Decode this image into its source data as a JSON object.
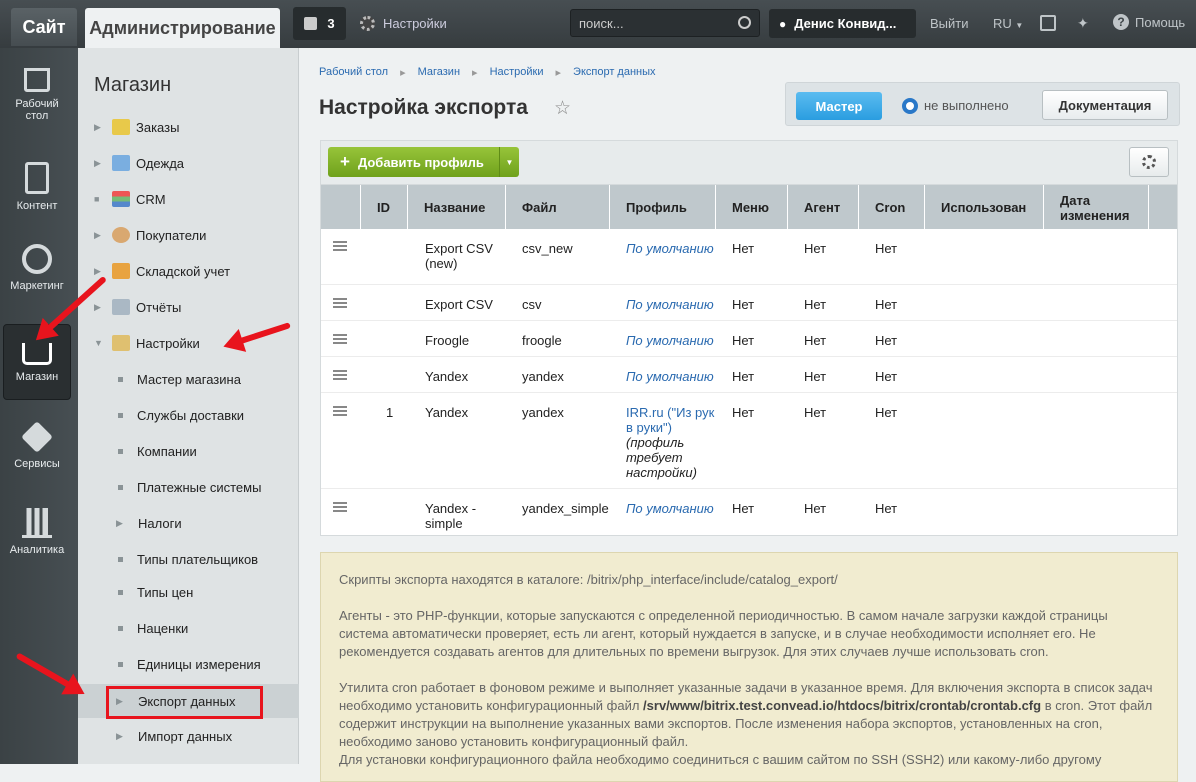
{
  "topbar": {
    "site": "Сайт",
    "admin": "Администрирование",
    "notify_count": "3",
    "settings": "Настройки",
    "search_placeholder": "поиск...",
    "user": "Денис Конвид...",
    "logout": "Выйти",
    "lang": "RU",
    "help": "Помощь"
  },
  "leftnav": {
    "items": [
      {
        "label1": "Рабочий",
        "label2": "стол"
      },
      {
        "label1": "Контент",
        "label2": ""
      },
      {
        "label1": "Маркетинг",
        "label2": ""
      },
      {
        "label1": "Магазин",
        "label2": ""
      },
      {
        "label1": "Сервисы",
        "label2": ""
      },
      {
        "label1": "Аналитика",
        "label2": ""
      }
    ]
  },
  "sidebar": {
    "title": "Магазин",
    "items": [
      "Заказы",
      "Одежда",
      "CRM",
      "Покупатели",
      "Складской учет",
      "Отчёты",
      "Настройки"
    ],
    "sub": [
      "Мастер магазина",
      "Службы доставки",
      "Компании",
      "Платежные системы",
      "Налоги",
      "Типы плательщиков",
      "Типы цен",
      "Наценки",
      "Единицы измерения",
      "Экспорт данных",
      "Импорт данных"
    ]
  },
  "breadcrumbs": [
    "Рабочий стол",
    "Магазин",
    "Настройки",
    "Экспорт данных"
  ],
  "page_title": "Настройка экспорта",
  "wizard": {
    "button": "Мастер",
    "status": "не выполнено",
    "docs": "Документация"
  },
  "toolbar": {
    "add": "Добавить профиль"
  },
  "table": {
    "headers": [
      "ID",
      "Название",
      "Файл",
      "Профиль",
      "Меню",
      "Агент",
      "Cron",
      "Использован",
      "Дата изменения"
    ],
    "rows": [
      {
        "id": "",
        "name": "Export CSV (new)",
        "file": "csv_new",
        "profile": "По умолчанию",
        "note": "",
        "menu": "Нет",
        "agent": "Нет",
        "cron": "Нет"
      },
      {
        "id": "",
        "name": "Export CSV",
        "file": "csv",
        "profile": "По умолчанию",
        "note": "",
        "menu": "Нет",
        "agent": "Нет",
        "cron": "Нет"
      },
      {
        "id": "",
        "name": "Froogle",
        "file": "froogle",
        "profile": "По умолчанию",
        "note": "",
        "menu": "Нет",
        "agent": "Нет",
        "cron": "Нет"
      },
      {
        "id": "",
        "name": "Yandex",
        "file": "yandex",
        "profile": "По умолчанию",
        "note": "",
        "menu": "Нет",
        "agent": "Нет",
        "cron": "Нет"
      },
      {
        "id": "1",
        "name": "Yandex",
        "file": "yandex",
        "profile": "IRR.ru (\"Из рук в руки\")",
        "note": "(профиль требует настройки)",
        "menu": "Нет",
        "agent": "Нет",
        "cron": "Нет"
      },
      {
        "id": "",
        "name": "Yandex - simple",
        "file": "yandex_simple",
        "profile": "По умолчанию",
        "note": "",
        "menu": "Нет",
        "agent": "Нет",
        "cron": "Нет"
      }
    ]
  },
  "info": {
    "p1": "Скрипты экспорта находятся в каталоге: /bitrix/php_interface/include/catalog_export/",
    "p2": "Агенты - это PHP-функции, которые запускаются с определенной периодичностью. В самом начале загрузки каждой страницы система автоматически проверяет, есть ли агент, который нуждается в запуске, и в случае необходимости исполняет его. Не рекомендуется создавать агентов для длительных по времени выгрузок. Для этих случаев лучше использовать cron.",
    "p3a": "Утилита cron работает в фоновом режиме и выполняет указанные задачи в указанное время. Для включения экспорта в список задач необходимо установить конфигурационный файл ",
    "p3b": "/srv/www/bitrix.test.convead.io/htdocs/bitrix/crontab/crontab.cfg",
    "p3c": " в cron. Этот файл содержит инструкции на выполнение указанных вами экспортов. После изменения набора экспортов, установленных на cron, необходимо заново установить конфигурационный файл.",
    "p4": "Для установки конфигурационного файла необходимо соединиться с вашим сайтом по SSH (SSH2) или какому-либо другому"
  }
}
